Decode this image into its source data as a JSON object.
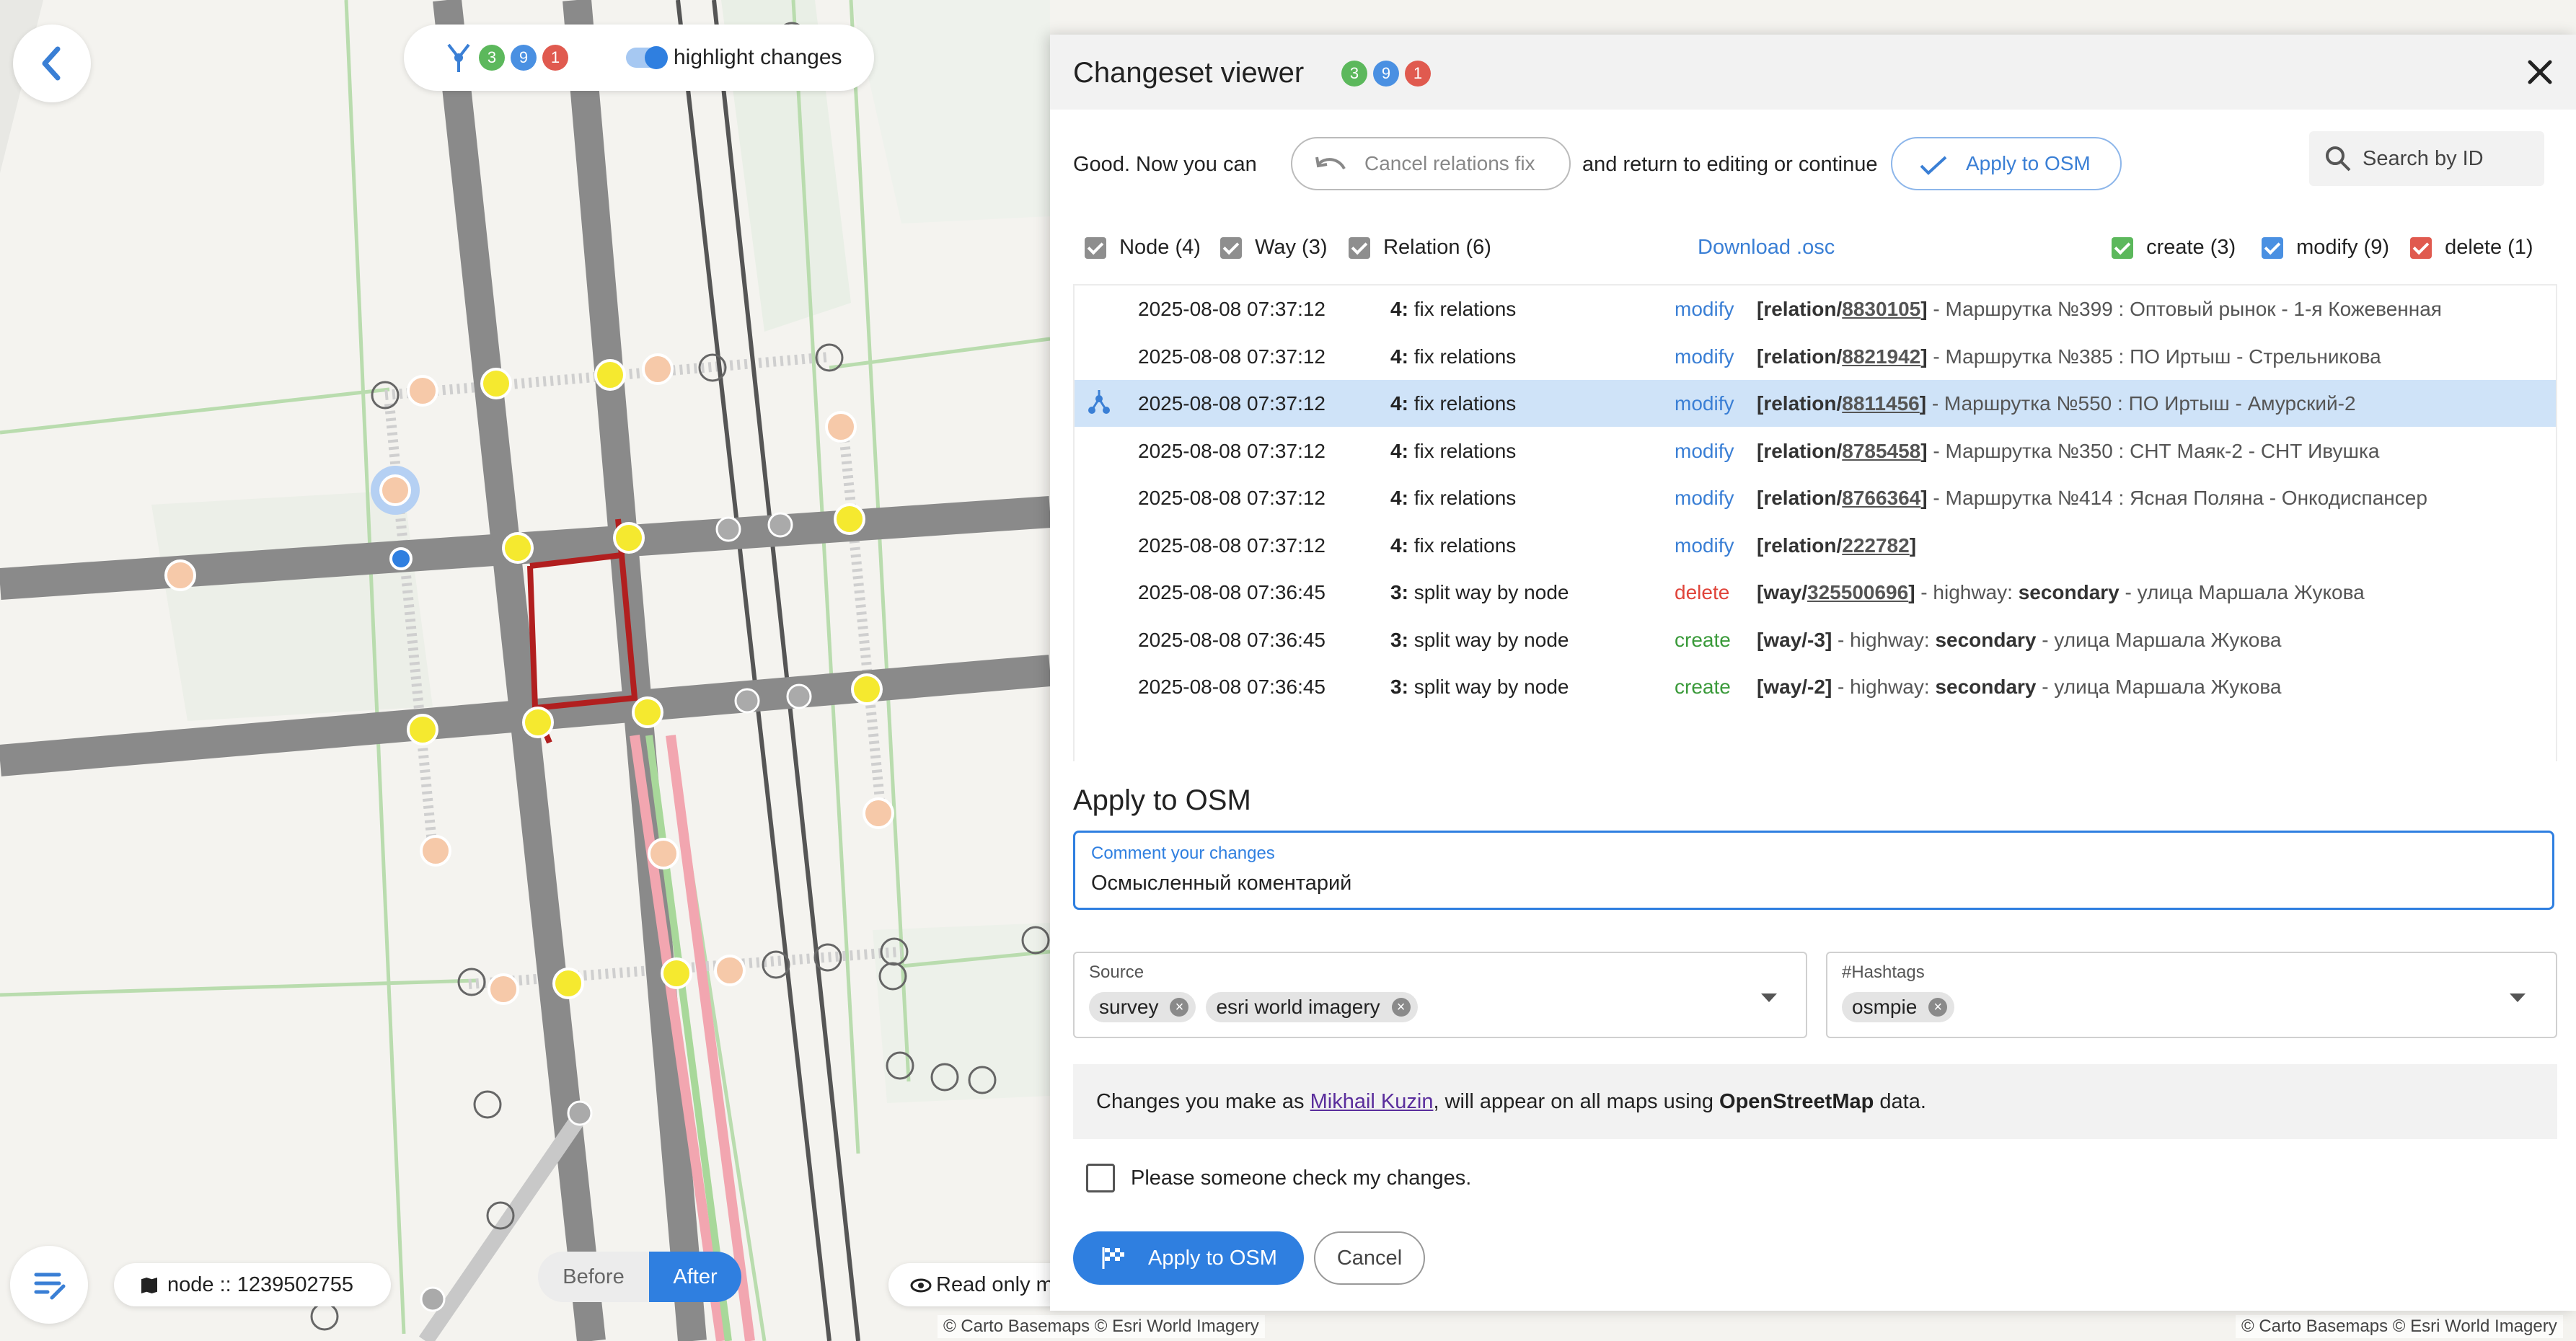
{
  "topbar": {
    "badges": {
      "create": "3",
      "modify": "9",
      "delete": "1"
    },
    "highlight_label": "highlight changes"
  },
  "map_footer": {
    "node_label": "node :: 1239502755",
    "before_label": "Before",
    "after_label": "After",
    "readonly_label": "Read only m",
    "attribution_left": "© Carto Basemaps © Esri World Imagery",
    "attribution_right": "© Carto Basemaps © Esri World Imagery"
  },
  "panel": {
    "title": "Changeset viewer",
    "badges": {
      "create": "3",
      "modify": "9",
      "delete": "1"
    },
    "info_prefix": "Good. Now you can",
    "cancel_fix_label": "Cancel relations fix",
    "info_middle": "and return to editing or continue",
    "apply_top_label": "Apply to OSM",
    "search_placeholder": "Search by ID",
    "filters": {
      "node": "Node (4)",
      "way": "Way (3)",
      "relation": "Relation (6)",
      "download": "Download .osc",
      "create": "create (3)",
      "modify": "modify (9)",
      "delete": "delete (1)"
    },
    "changes": [
      {
        "time": "2025-08-08 07:37:12",
        "step": "4:",
        "action": "fix relations",
        "op": "modify",
        "ref_type": "relation/",
        "ref_id": "8830105",
        "suffix": " - Маршрутка №399 : Оптовый рынок - 1-я Кожевенная"
      },
      {
        "time": "2025-08-08 07:37:12",
        "step": "4:",
        "action": "fix relations",
        "op": "modify",
        "ref_type": "relation/",
        "ref_id": "8821942",
        "suffix": " - Маршрутка №385 : ПО Иртыш - Стрельникова"
      },
      {
        "time": "2025-08-08 07:37:12",
        "step": "4:",
        "action": "fix relations",
        "op": "modify",
        "ref_type": "relation/",
        "ref_id": "8811456",
        "suffix": " - Маршрутка №550 : ПО Иртыш - Амурский-2",
        "selected": true
      },
      {
        "time": "2025-08-08 07:37:12",
        "step": "4:",
        "action": "fix relations",
        "op": "modify",
        "ref_type": "relation/",
        "ref_id": "8785458",
        "suffix": " - Маршрутка №350 : СНТ Маяк-2 - СНТ Ивушка"
      },
      {
        "time": "2025-08-08 07:37:12",
        "step": "4:",
        "action": "fix relations",
        "op": "modify",
        "ref_type": "relation/",
        "ref_id": "8766364",
        "suffix": " - Маршрутка №414 : Ясная Поляна - Онкодиспансер"
      },
      {
        "time": "2025-08-08 07:37:12",
        "step": "4:",
        "action": "fix relations",
        "op": "modify",
        "ref_type": "relation/",
        "ref_id": "222782",
        "suffix": ""
      },
      {
        "time": "2025-08-08 07:36:45",
        "step": "3:",
        "action": "split way by node",
        "op": "delete",
        "ref_type": "way/",
        "ref_id": "325500696",
        "suffix_pre": " - highway: ",
        "suffix_bold": "secondary",
        "suffix": " - улица Маршала Жукова"
      },
      {
        "time": "2025-08-08 07:36:45",
        "step": "3:",
        "action": "split way by node",
        "op": "create",
        "ref_type": "way/-3",
        "ref_id": "",
        "suffix_pre": " - highway: ",
        "suffix_bold": "secondary",
        "suffix": " - улица Маршала Жукова"
      },
      {
        "time": "2025-08-08 07:36:45",
        "step": "3:",
        "action": "split way by node",
        "op": "create",
        "ref_type": "way/-2",
        "ref_id": "",
        "suffix_pre": " - highway: ",
        "suffix_bold": "secondary",
        "suffix": " - улица Маршала Жукова"
      }
    ],
    "apply_heading": "Apply to OSM",
    "comment_label": "Comment your changes",
    "comment_value": "Осмысленный коментарий",
    "source_label": "Source",
    "source_chips": [
      "survey",
      "esri world imagery"
    ],
    "hashtags_label": "#Hashtags",
    "hashtag_chips": [
      "osmpie"
    ],
    "notice_prefix": "Changes you make as ",
    "notice_user": "Mikhail Kuzin",
    "notice_middle": ", will appear on all maps using ",
    "notice_bold": "OpenStreetMap",
    "notice_suffix": " data.",
    "review_label": "Please someone check my changes.",
    "apply_button": "Apply to OSM",
    "cancel_button": "Cancel"
  },
  "colors": {
    "accent": "#3a7fd5",
    "create": "#5cb85c",
    "modify": "#4a90e2",
    "delete": "#e05a4f",
    "selected_row": "#cfe3f8"
  }
}
